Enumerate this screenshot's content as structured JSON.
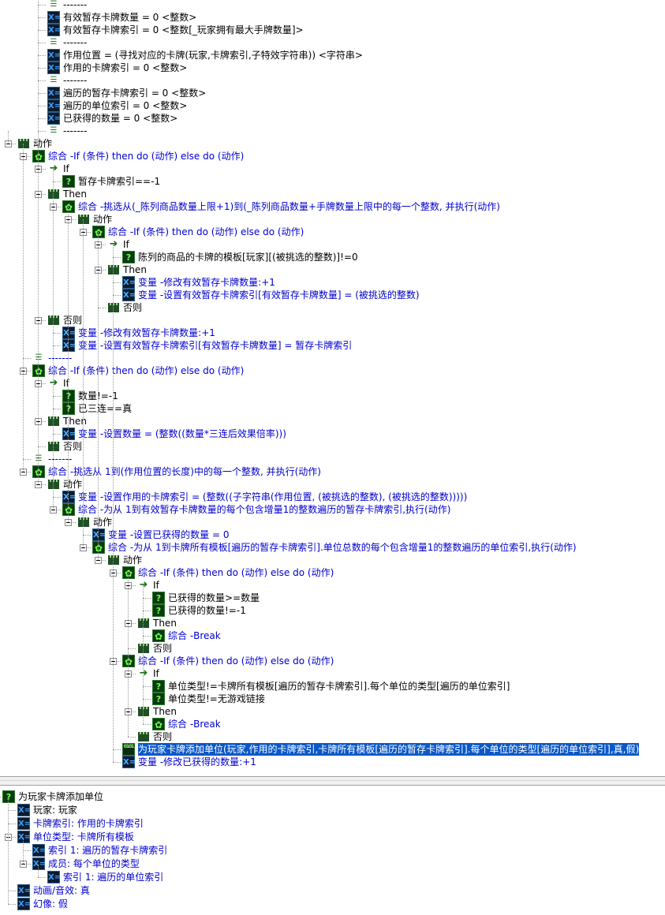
{
  "top_tree": [
    {
      "text": "-------",
      "icon": "separator-icon",
      "indent": 2,
      "color": "black"
    },
    {
      "text": "有效暂存卡牌数量 = 0 <整数>",
      "icon": "variable-icon",
      "indent": 2,
      "color": "black"
    },
    {
      "text": "有效暂存卡牌索引 = 0 <整数[_玩家拥有最大手牌数量]>",
      "icon": "variable-icon",
      "indent": 2,
      "color": "black"
    },
    {
      "text": "-------",
      "icon": "separator-icon",
      "indent": 2,
      "color": "black"
    },
    {
      "text": "作用位置 = (寻找对应的卡牌(玩家,卡牌索引,子特效字符串)) <字符串>",
      "icon": "variable-icon",
      "indent": 2,
      "color": "black"
    },
    {
      "text": "作用的卡牌索引 = 0 <整数>",
      "icon": "variable-icon",
      "indent": 2,
      "color": "black"
    },
    {
      "text": "-------",
      "icon": "separator-icon",
      "indent": 2,
      "color": "black"
    },
    {
      "text": "遍历的暂存卡牌索引 = 0 <整数>",
      "icon": "variable-icon",
      "indent": 2,
      "color": "black"
    },
    {
      "text": "遍历的单位索引 = 0 <整数>",
      "icon": "variable-icon",
      "indent": 2,
      "color": "black"
    },
    {
      "text": "已获得的数量 = 0 <整数>",
      "icon": "variable-icon",
      "indent": 2,
      "color": "black"
    },
    {
      "text": "-------",
      "icon": "separator-icon",
      "indent": 2,
      "color": "black"
    },
    {
      "text": "动作",
      "icon": "actions-icon",
      "indent": 0,
      "color": "black",
      "expanded": true
    },
    {
      "text": "综合 -If (条件) then do (动作) else do (动作)",
      "icon": "composite-icon",
      "indent": 1,
      "color": "blue",
      "expanded": true
    },
    {
      "text": "If",
      "icon": "if-arrow-icon",
      "indent": 2,
      "color": "black",
      "expanded": true
    },
    {
      "text": "暂存卡牌索引==-1",
      "icon": "condition-icon",
      "indent": 3,
      "color": "black"
    },
    {
      "text": "Then",
      "icon": "actions-icon",
      "indent": 2,
      "color": "black",
      "expanded": true
    },
    {
      "text": "综合 -挑选从(_陈列商品数量上限+1)到(_陈列商品数量+手牌数量上限中的每一个整数, 并执行(动作)",
      "icon": "composite-icon",
      "indent": 3,
      "color": "blue",
      "expanded": true
    },
    {
      "text": "动作",
      "icon": "actions-icon",
      "indent": 4,
      "color": "black",
      "expanded": true
    },
    {
      "text": "综合 -If (条件) then do (动作) else do (动作)",
      "icon": "composite-icon",
      "indent": 5,
      "color": "blue",
      "expanded": true
    },
    {
      "text": "If",
      "icon": "if-arrow-icon",
      "indent": 6,
      "color": "black",
      "expanded": true
    },
    {
      "text": "陈列的商品的卡牌的模板[玩家][(被挑选的整数)]!=0",
      "icon": "condition-icon",
      "indent": 7,
      "color": "black"
    },
    {
      "text": "Then",
      "icon": "actions-icon",
      "indent": 6,
      "color": "black",
      "expanded": true
    },
    {
      "text": "变量 -修改有效暂存卡牌数量:+1",
      "icon": "set-variable-icon",
      "indent": 7,
      "color": "blue"
    },
    {
      "text": "变量 -设置有效暂存卡牌索引[有效暂存卡牌数量] = (被挑选的整数)",
      "icon": "set-variable-icon",
      "indent": 7,
      "color": "blue"
    },
    {
      "text": "否则",
      "icon": "actions-icon",
      "indent": 6,
      "color": "black"
    },
    {
      "text": "否则",
      "icon": "actions-icon",
      "indent": 2,
      "color": "black",
      "expanded": true
    },
    {
      "text": "变量 -修改有效暂存卡牌数量:+1",
      "icon": "set-variable-icon",
      "indent": 3,
      "color": "blue"
    },
    {
      "text": "变量 -设置有效暂存卡牌索引[有效暂存卡牌数量] = 暂存卡牌索引",
      "icon": "set-variable-icon",
      "indent": 3,
      "color": "blue"
    },
    {
      "text": "-------",
      "icon": "separator-icon",
      "indent": 1,
      "color": "blue"
    },
    {
      "text": "综合 -If (条件) then do (动作) else do (动作)",
      "icon": "composite-icon",
      "indent": 1,
      "color": "blue",
      "expanded": true
    },
    {
      "text": "If",
      "icon": "if-arrow-icon",
      "indent": 2,
      "color": "black",
      "expanded": true
    },
    {
      "text": "数量!=-1",
      "icon": "condition-icon",
      "indent": 3,
      "color": "black"
    },
    {
      "text": "已三连==真",
      "icon": "condition-icon",
      "indent": 3,
      "color": "black"
    },
    {
      "text": "Then",
      "icon": "actions-icon",
      "indent": 2,
      "color": "black",
      "expanded": true
    },
    {
      "text": "变量 -设置数量 = (整数((数量*三连后效果倍率)))",
      "icon": "set-variable-icon",
      "indent": 3,
      "color": "blue"
    },
    {
      "text": "否则",
      "icon": "actions-icon",
      "indent": 2,
      "color": "black"
    },
    {
      "text": "-------",
      "icon": "separator-icon",
      "indent": 1,
      "color": "blue"
    },
    {
      "text": "综合 -挑选从 1到(作用位置的长度)中的每一个整数, 并执行(动作)",
      "icon": "composite-icon",
      "indent": 1,
      "color": "blue",
      "expanded": true
    },
    {
      "text": "动作",
      "icon": "actions-icon",
      "indent": 2,
      "color": "black",
      "expanded": true
    },
    {
      "text": "变量 -设置作用的卡牌索引 = (整数((子字符串(作用位置, (被挑选的整数), (被挑选的整数)))))",
      "icon": "set-variable-icon",
      "indent": 3,
      "color": "blue"
    },
    {
      "text": "综合 -为从 1到有效暂存卡牌数量的每个包含增量1的整数遍历的暂存卡牌索引,执行(动作)",
      "icon": "composite-icon",
      "indent": 3,
      "color": "blue",
      "expanded": true
    },
    {
      "text": "动作",
      "icon": "actions-icon",
      "indent": 4,
      "color": "black",
      "expanded": true
    },
    {
      "text": "变量 -设置已获得的数量 = 0",
      "icon": "set-variable-icon",
      "indent": 5,
      "color": "blue"
    },
    {
      "text": "综合 -为从 1到卡牌所有模板[遍历的暂存卡牌索引].单位总数的每个包含增量1的整数遍历的单位索引,执行(动作)",
      "icon": "composite-icon",
      "indent": 5,
      "color": "blue",
      "expanded": true
    },
    {
      "text": "动作",
      "icon": "actions-icon",
      "indent": 6,
      "color": "black",
      "expanded": true
    },
    {
      "text": "综合 -If (条件) then do (动作) else do (动作)",
      "icon": "composite-icon",
      "indent": 7,
      "color": "blue",
      "expanded": true
    },
    {
      "text": "If",
      "icon": "if-arrow-icon",
      "indent": 8,
      "color": "black",
      "expanded": true
    },
    {
      "text": "已获得的数量>=数量",
      "icon": "condition-icon",
      "indent": 9,
      "color": "black"
    },
    {
      "text": "已获得的数量!=-1",
      "icon": "condition-icon",
      "indent": 9,
      "color": "black"
    },
    {
      "text": "Then",
      "icon": "actions-icon",
      "indent": 8,
      "color": "black",
      "expanded": true
    },
    {
      "text": "综合 -Break",
      "icon": "composite-icon",
      "indent": 9,
      "color": "blue"
    },
    {
      "text": "否则",
      "icon": "actions-icon",
      "indent": 8,
      "color": "black"
    },
    {
      "text": "综合 -If (条件) then do (动作) else do (动作)",
      "icon": "composite-icon",
      "indent": 7,
      "color": "blue",
      "expanded": true
    },
    {
      "text": "If",
      "icon": "if-arrow-icon",
      "indent": 8,
      "color": "black",
      "expanded": true
    },
    {
      "text": "单位类型!=卡牌所有模板[遍历的暂存卡牌索引].每个单位的类型[遍历的单位索引]",
      "icon": "condition-icon",
      "indent": 9,
      "color": "black"
    },
    {
      "text": "单位类型!=无游戏链接",
      "icon": "condition-icon",
      "indent": 9,
      "color": "black"
    },
    {
      "text": "Then",
      "icon": "actions-icon",
      "indent": 8,
      "color": "black",
      "expanded": true
    },
    {
      "text": "综合 -Break",
      "icon": "composite-icon",
      "indent": 9,
      "color": "blue"
    },
    {
      "text": "否则",
      "icon": "actions-icon",
      "indent": 8,
      "color": "black"
    },
    {
      "text": "为玩家卡牌添加单位(玩家,作用的卡牌索引,卡牌所有模板[遍历的暂存卡牌索引].每个单位的类型[遍历的单位索引],真,假)",
      "icon": "function-call-icon",
      "indent": 7,
      "color": "blue",
      "selected": true
    },
    {
      "text": "变量 -修改已获得的数量:+1",
      "icon": "set-variable-icon",
      "indent": 7,
      "color": "blue"
    }
  ],
  "bottom_tree": [
    {
      "text": "为玩家卡牌添加单位",
      "icon": "condition-icon",
      "indent": 0,
      "color": "black"
    },
    {
      "text": "玩家: 玩家",
      "icon": "parameter-icon",
      "indent": 1,
      "color": "black"
    },
    {
      "text": "卡牌索引: 作用的卡牌索引",
      "icon": "parameter-icon",
      "indent": 1,
      "color": "blue"
    },
    {
      "text": "单位类型: 卡牌所有模板",
      "icon": "parameter-icon",
      "indent": 1,
      "color": "blue",
      "expanded": true
    },
    {
      "text": "索引 1: 遍历的暂存卡牌索引",
      "icon": "parameter-icon",
      "indent": 2,
      "color": "blue"
    },
    {
      "text": "成员: 每个单位的类型",
      "icon": "parameter-icon",
      "indent": 2,
      "color": "blue",
      "expanded": true
    },
    {
      "text": "索引 1: 遍历的单位索引",
      "icon": "parameter-icon",
      "indent": 3,
      "color": "blue"
    },
    {
      "text": "动画/音效: 真",
      "icon": "parameter-icon",
      "indent": 1,
      "color": "blue"
    },
    {
      "text": "幻像: 假",
      "icon": "parameter-icon",
      "indent": 1,
      "color": "blue"
    }
  ],
  "colors": {
    "text_blue": "#0000d0",
    "selection": "#0a58c8",
    "icon_green": "#1e4f25"
  }
}
